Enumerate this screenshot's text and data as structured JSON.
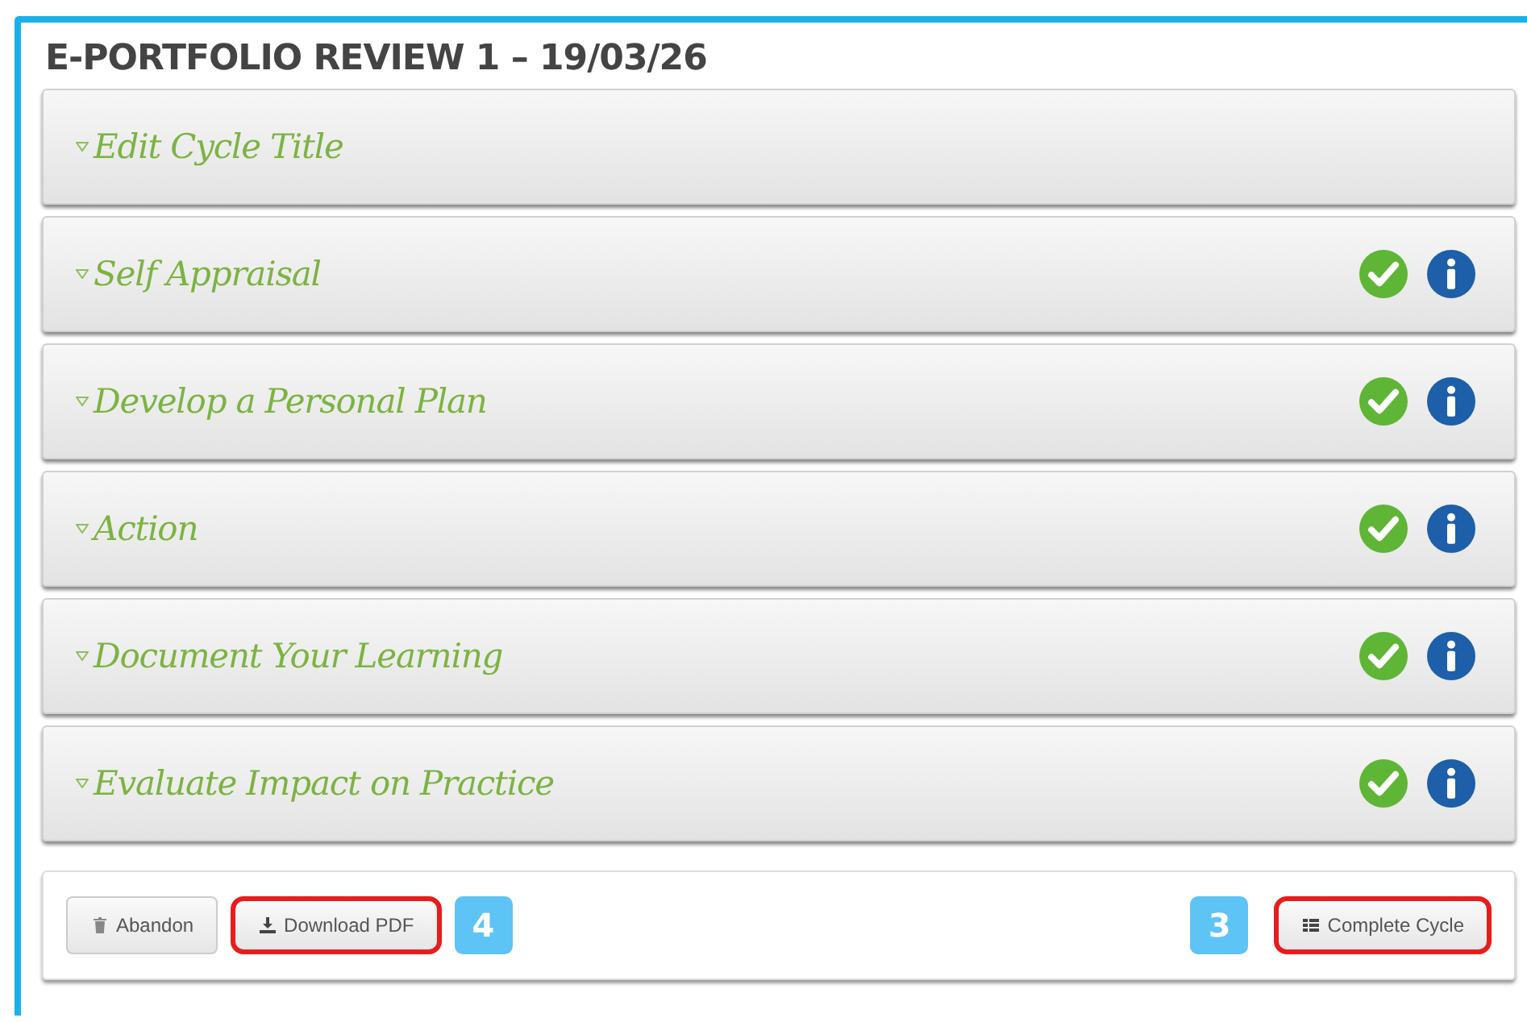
{
  "title": "E-PORTFOLIO REVIEW 1 – 19/03/26",
  "sections": [
    {
      "label": "Edit Cycle Title",
      "complete": false,
      "info": false
    },
    {
      "label": "Self Appraisal",
      "complete": true,
      "info": true
    },
    {
      "label": "Develop a Personal Plan",
      "complete": true,
      "info": true
    },
    {
      "label": "Action",
      "complete": true,
      "info": true
    },
    {
      "label": "Document Your Learning",
      "complete": true,
      "info": true
    },
    {
      "label": "Evaluate Impact on Practice",
      "complete": true,
      "info": true
    }
  ],
  "footer": {
    "left_buttons": [
      {
        "label": "Abandon",
        "kind": "trash",
        "highlighted": false
      },
      {
        "label": "Download PDF",
        "kind": "download",
        "highlighted": true,
        "callout": "4"
      }
    ],
    "right_buttons": [
      {
        "label": "Complete Cycle",
        "kind": "list",
        "highlighted": true,
        "callout": "3"
      }
    ]
  }
}
